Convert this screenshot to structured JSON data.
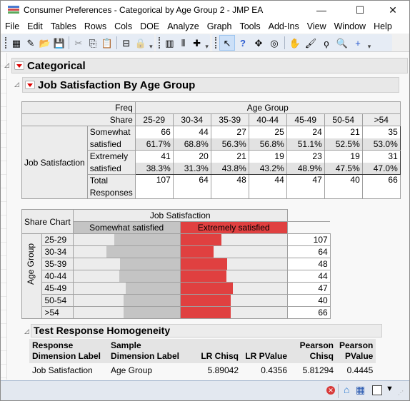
{
  "window": {
    "title": "Consumer Preferences - Categorical by Age Group 2 - JMP EA",
    "controls": {
      "minimize": "—",
      "maximize": "☐",
      "close": "✕"
    }
  },
  "menubar": [
    "File",
    "Edit",
    "Tables",
    "Rows",
    "Cols",
    "DOE",
    "Analyze",
    "Graph",
    "Tools",
    "Add-Ins",
    "View",
    "Window",
    "Help"
  ],
  "toolbar": {
    "group1": [
      {
        "name": "new-data-table-icon",
        "glyph": "▦"
      },
      {
        "name": "new-script-icon",
        "glyph": "✎"
      },
      {
        "name": "open-folder-icon",
        "glyph": "📂"
      },
      {
        "name": "save-icon",
        "glyph": "💾"
      },
      {
        "name": "cut-icon",
        "glyph": "✂"
      },
      {
        "name": "copy-icon",
        "glyph": "⎘"
      },
      {
        "name": "paste-icon",
        "glyph": "📋"
      },
      {
        "name": "journal-icon",
        "glyph": "⊟"
      },
      {
        "name": "lock-icon",
        "glyph": "🔒"
      }
    ],
    "group2": [
      {
        "name": "data-grid-icon",
        "glyph": "▥"
      },
      {
        "name": "columns-icon",
        "glyph": "⫴"
      },
      {
        "name": "add-image-icon",
        "glyph": "✚"
      }
    ],
    "group3": [
      {
        "name": "arrow-tool-icon",
        "glyph": "↖"
      },
      {
        "name": "help-tool-icon",
        "glyph": "?"
      },
      {
        "name": "selection-tool-icon",
        "glyph": "✥"
      },
      {
        "name": "scroller-tool-icon",
        "glyph": "◎"
      },
      {
        "name": "grabber-tool-icon",
        "glyph": "✋"
      },
      {
        "name": "brush-tool-icon",
        "glyph": "🖌"
      },
      {
        "name": "lasso-tool-icon",
        "glyph": "ϙ"
      },
      {
        "name": "magnifier-tool-icon",
        "glyph": "🔍"
      },
      {
        "name": "crosshair-tool-icon",
        "glyph": "+"
      }
    ]
  },
  "report": {
    "outline_title": "Categorical",
    "sub_title": "Job Satisfaction By Age Group",
    "crosstab": {
      "freq_label": "Freq",
      "share_label": "Share",
      "col_group": "Age Group",
      "row_group": "Job Satisfaction",
      "columns": [
        "25-29",
        "30-34",
        "35-39",
        "40-44",
        "45-49",
        "50-54",
        ">54"
      ],
      "rows": [
        {
          "label1": "Somewhat",
          "label2": "satisfied",
          "freq": [
            "66",
            "44",
            "27",
            "25",
            "24",
            "21",
            "35"
          ],
          "share": [
            "61.7%",
            "68.8%",
            "56.3%",
            "56.8%",
            "51.1%",
            "52.5%",
            "53.0%"
          ]
        },
        {
          "label1": "Extremely",
          "label2": "satisfied",
          "freq": [
            "41",
            "20",
            "21",
            "19",
            "23",
            "19",
            "31"
          ],
          "share": [
            "38.3%",
            "31.3%",
            "43.8%",
            "43.2%",
            "48.9%",
            "47.5%",
            "47.0%"
          ]
        }
      ],
      "total_label1": "Total",
      "total_label2": "Responses",
      "totals": [
        "107",
        "64",
        "48",
        "44",
        "47",
        "40",
        "66"
      ]
    },
    "share_chart": {
      "title": "Share Chart",
      "group_label": "Job Satisfaction",
      "row_axis": "Age Group",
      "legend": [
        {
          "label": "Somewhat satisfied",
          "color": "#c4c4c4"
        },
        {
          "label": "Extremely satisfied",
          "color": "#e04040"
        }
      ],
      "rows": [
        {
          "label": "25-29",
          "somewhat": 0.617,
          "extremely": 0.383,
          "n": "107"
        },
        {
          "label": "30-34",
          "somewhat": 0.688,
          "extremely": 0.313,
          "n": "64"
        },
        {
          "label": "35-39",
          "somewhat": 0.563,
          "extremely": 0.438,
          "n": "48"
        },
        {
          "label": "40-44",
          "somewhat": 0.568,
          "extremely": 0.432,
          "n": "44"
        },
        {
          "label": "45-49",
          "somewhat": 0.511,
          "extremely": 0.489,
          "n": "47"
        },
        {
          "label": "50-54",
          "somewhat": 0.525,
          "extremely": 0.475,
          "n": "40"
        },
        {
          "label": ">54",
          "somewhat": 0.53,
          "extremely": 0.47,
          "n": "66"
        }
      ]
    },
    "test": {
      "title": "Test Response Homogeneity",
      "headers": [
        [
          "Response",
          "Dimension Label"
        ],
        [
          "Sample",
          "Dimension Label"
        ],
        [
          "",
          "LR Chisq"
        ],
        [
          "",
          "LR PValue"
        ],
        [
          "Pearson",
          "Chisq"
        ],
        [
          "Pearson",
          "PValue"
        ]
      ],
      "row": [
        "Job Satisfaction",
        "Age Group",
        "5.89042",
        "0.4356",
        "5.81294",
        "0.4445"
      ]
    }
  },
  "statusbar": {
    "icons": [
      "error-icon",
      "home-icon",
      "data-table-icon",
      "window-list-icon"
    ]
  }
}
